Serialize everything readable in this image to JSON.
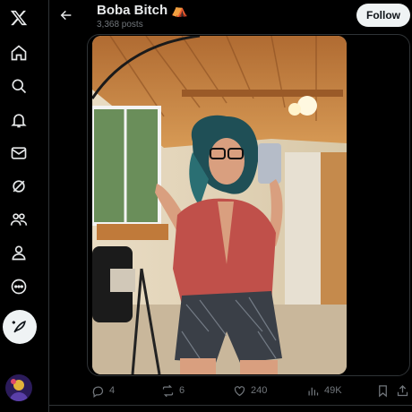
{
  "nav": {
    "items": [
      {
        "name": "x-logo"
      },
      {
        "name": "home"
      },
      {
        "name": "explore"
      },
      {
        "name": "notifications"
      },
      {
        "name": "messages"
      },
      {
        "name": "grok"
      },
      {
        "name": "communities"
      },
      {
        "name": "profile"
      },
      {
        "name": "more"
      }
    ],
    "post_button_icon": "feather-plus-icon"
  },
  "header": {
    "title": "Boba Bitch",
    "title_emoji": "⛺",
    "post_count": "3,368 posts",
    "follow_label": "Follow"
  },
  "post": {
    "actions": {
      "replies": "4",
      "reposts": "6",
      "likes": "240",
      "views": "49K"
    }
  },
  "colors": {
    "background": "#000000",
    "text": "#e7e9ea",
    "muted": "#71767b",
    "border": "#2f3336",
    "follow_bg": "#eff3f4"
  }
}
